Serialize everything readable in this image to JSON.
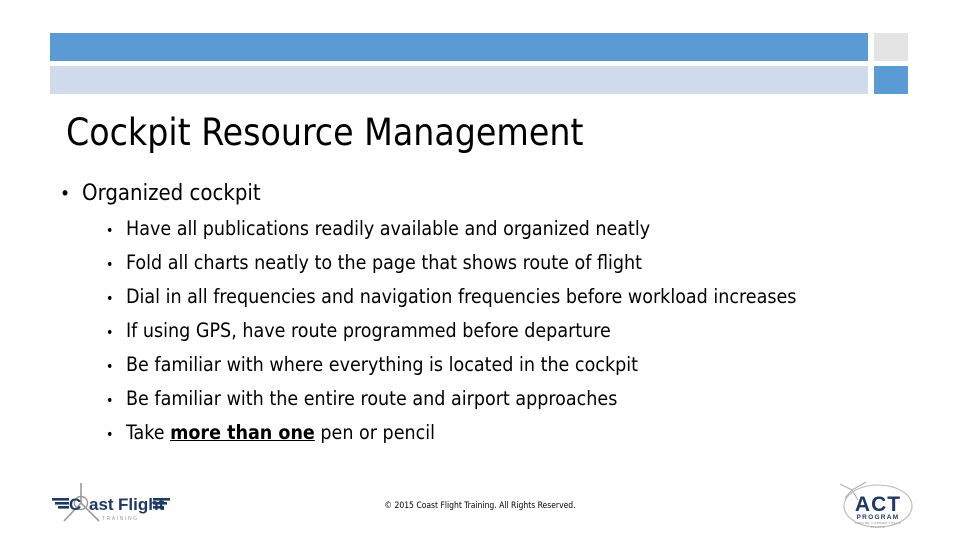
{
  "slide": {
    "title": "Cockpit Resource Management",
    "bullets": [
      {
        "marker": "•",
        "text": "Organized cockpit",
        "children": [
          {
            "marker": "•",
            "text": "Have all publications readily available and organized neatly"
          },
          {
            "marker": "•",
            "text": "Fold all charts neatly to the page that shows route of flight"
          },
          {
            "marker": "•",
            "text": "Dial in all frequencies and navigation frequencies before workload increases"
          },
          {
            "marker": "•",
            "text": "If using GPS, have route programmed before departure"
          },
          {
            "marker": "•",
            "text": "Be familiar with where everything is located in the cockpit"
          },
          {
            "marker": "•",
            "text": "Be familiar with the entire route and airport approaches"
          }
        ]
      }
    ],
    "last_bullet": {
      "marker": "•",
      "prefix": "Take ",
      "emphasis": "more than one",
      "suffix": " pen or pencil"
    }
  },
  "footer": {
    "copyright": "© 2015 Coast Flight Training. All Rights Reserved."
  },
  "logos": {
    "left": {
      "name": "coast-flight-training-logo",
      "word_one": "C",
      "word_two": "ast",
      "word_three": "Flight",
      "tagline": "T R A I N I N G"
    },
    "right": {
      "name": "act-program-logo",
      "acronym": "ACT",
      "subtitle": "PROGRAM",
      "fineprint_line1": "AIRLINE CAREER TRACK",
      "fineprint_line2": "PILOTS"
    }
  },
  "colors": {
    "accent_primary": "#5b9bd5",
    "accent_secondary": "#d0dcee",
    "accent_gray": "#e4e4e4",
    "text": "#000000",
    "logo_navy": "#1f3864",
    "logo_gray": "#8a8a8a"
  }
}
